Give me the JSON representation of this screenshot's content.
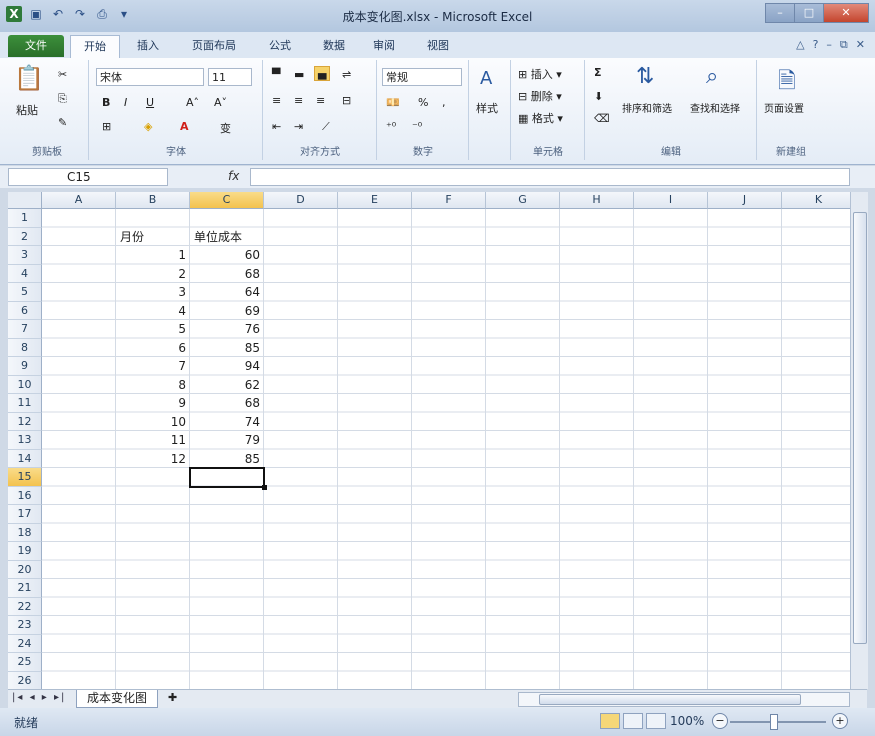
{
  "window": {
    "title": "成本变化图.xlsx - Microsoft Excel",
    "minimize_icon": "minimize-icon",
    "maximize_icon": "maximize-icon",
    "close_icon": "close-icon"
  },
  "quick_access": [
    "excel-logo-icon",
    "save-icon",
    "undo-icon",
    "redo-icon",
    "print-preview-icon",
    "customize-icon"
  ],
  "tabs": [
    {
      "label": "文件"
    },
    {
      "label": "开始"
    },
    {
      "label": "插入"
    },
    {
      "label": "页面布局"
    },
    {
      "label": "公式"
    },
    {
      "label": "数据"
    },
    {
      "label": "审阅"
    },
    {
      "label": "视图"
    }
  ],
  "ribbon": {
    "clipboard": {
      "paste": "粘贴",
      "label": "剪贴板"
    },
    "font": {
      "name": "宋体",
      "size": "11",
      "label": "字体"
    },
    "alignment": {
      "label": "对齐方式"
    },
    "number": {
      "format": "常规",
      "label": "数字",
      "percent": "%"
    },
    "styles": {
      "label": "样式"
    },
    "cells": {
      "insert": "插入",
      "delete": "删除",
      "format": "格式",
      "label": "单元格"
    },
    "editing": {
      "sort_filter": "排序和筛选",
      "find_select": "查找和选择",
      "label": "编辑"
    },
    "new_group": {
      "page_setup": "页面设置",
      "label": "新建组"
    }
  },
  "formula_bar": {
    "name_box": "C15",
    "fx": "fx",
    "value": ""
  },
  "columns": [
    "A",
    "B",
    "C",
    "D",
    "E",
    "F",
    "G",
    "H",
    "I",
    "J",
    "K"
  ],
  "selected_column": "C",
  "rows": [
    "1",
    "2",
    "3",
    "4",
    "5",
    "6",
    "7",
    "8",
    "9",
    "10",
    "11",
    "12",
    "13",
    "14",
    "15",
    "16",
    "17",
    "18",
    "19",
    "20",
    "21",
    "22",
    "23",
    "24",
    "25",
    "26"
  ],
  "selected_row": "15",
  "cells": {
    "headers": {
      "B2": "月份",
      "C2": "单位成本"
    },
    "months": [
      "1",
      "2",
      "3",
      "4",
      "5",
      "6",
      "7",
      "8",
      "9",
      "10",
      "11",
      "12"
    ],
    "costs": [
      "60",
      "68",
      "64",
      "69",
      "76",
      "85",
      "94",
      "62",
      "68",
      "74",
      "79",
      "85"
    ]
  },
  "sheet_tabs": [
    {
      "label": "成本变化图"
    }
  ],
  "status": {
    "ready": "就绪",
    "zoom": "100%"
  }
}
